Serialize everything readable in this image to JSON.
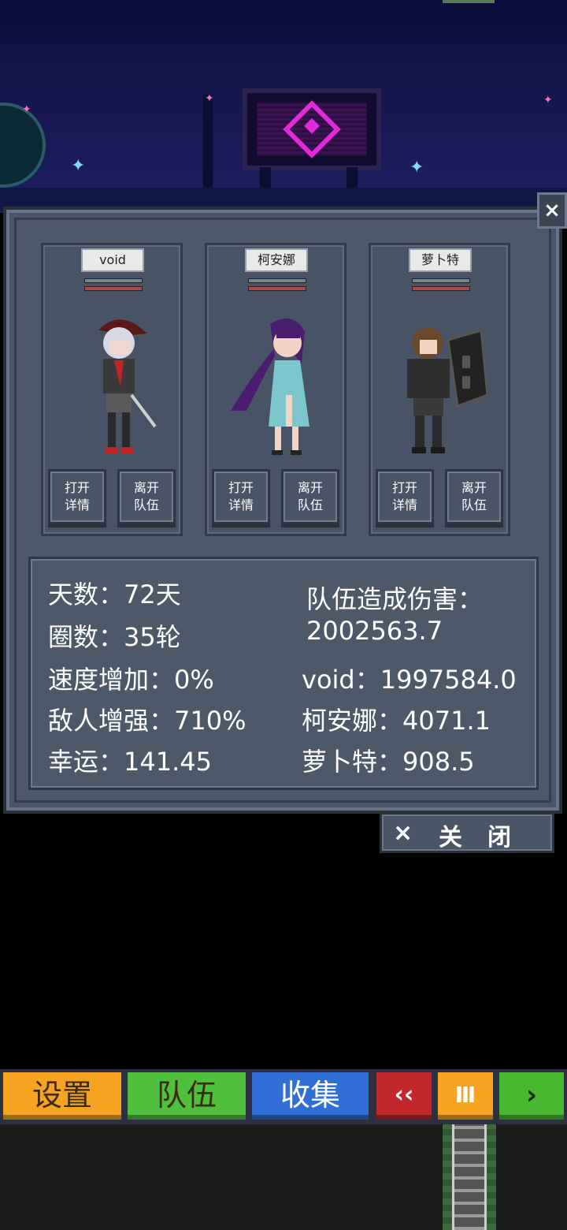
{
  "party": {
    "members": [
      {
        "name": "void",
        "open_details": "打开\n详情",
        "leave_party": "离开\n队伍"
      },
      {
        "name": "柯安娜",
        "open_details": "打开\n详情",
        "leave_party": "离开\n队伍"
      },
      {
        "name": "萝卜特",
        "open_details": "打开\n详情",
        "leave_party": "离开\n队伍"
      }
    ]
  },
  "stats": {
    "days": "天数：72天",
    "rounds": "圈数：35轮",
    "speed_bonus": "速度增加：0%",
    "enemy_boost": "敌人增强：710%",
    "luck": "幸运：141.45",
    "team_damage_label": "队伍造成伤害：",
    "team_damage_value": "2002563.7",
    "damage_void": "void：1997584.0",
    "damage_kena": "柯安娜：4071.1",
    "damage_luobote": "萝卜特：908.5"
  },
  "dialog": {
    "close_icon": "×",
    "close_button_icon": "×",
    "close_button_label": "关闭"
  },
  "toolbar": {
    "settings": "设置",
    "team": "队伍",
    "collection": "收集",
    "rewind": "‹‹",
    "pause": "Ⅲ",
    "play": "›",
    "colors": {
      "settings": "#f5a320",
      "team": "#4fbf3c",
      "collection": "#2f6fd6",
      "rewind": "#c1272d",
      "pause": "#f5a320",
      "play": "#47b82f"
    }
  }
}
